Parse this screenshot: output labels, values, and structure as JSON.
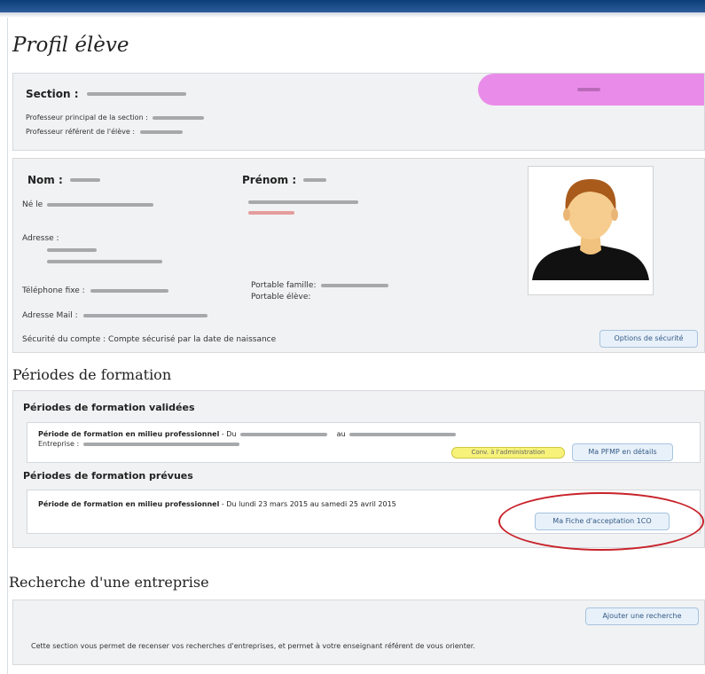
{
  "page": {
    "title": "Profil élève"
  },
  "section_box": {
    "section_label": "Section :",
    "prof_principal_label": "Professeur principal de la section :",
    "prof_referent_label": "Professeur référent de l'élève :"
  },
  "identity": {
    "nom_label": "Nom :",
    "prenom_label": "Prénom :",
    "ne_le_label": "Né le",
    "adresse_label": "Adresse :",
    "telephone_fixe_label": "Téléphone fixe :",
    "portable_famille_label": "Portable famille:",
    "portable_eleve_label": "Portable élève:",
    "adresse_mail_label": "Adresse Mail :",
    "securite_text": "Sécurité du compte : Compte sécurisé par la date de naissance",
    "security_button": "Options de sécurité"
  },
  "periodes": {
    "title": "Périodes de formation",
    "validees_title": "Périodes de formation validées",
    "validee_item": {
      "title": "Période de formation en milieu professionnel",
      "du_label": "- Du",
      "au_label": "au",
      "entreprise_label": "Entreprise :",
      "badge": "Conv. à l'administration",
      "detail_button": "Ma PFMP en détails"
    },
    "prevues_title": "Périodes de formation prévues",
    "prevue_item": {
      "title": "Période de formation en milieu professionnel",
      "dates": "- Du lundi 23 mars 2015 au samedi 25 avril 2015",
      "fiche_button": "Ma Fiche d'acceptation 1CO"
    }
  },
  "recherche": {
    "title": "Recherche d'une entreprise",
    "add_button": "Ajouter une recherche",
    "description": "Cette section vous permet de recenser vos recherches d'entreprises, et permet à votre enseignant référent de vous orienter."
  }
}
